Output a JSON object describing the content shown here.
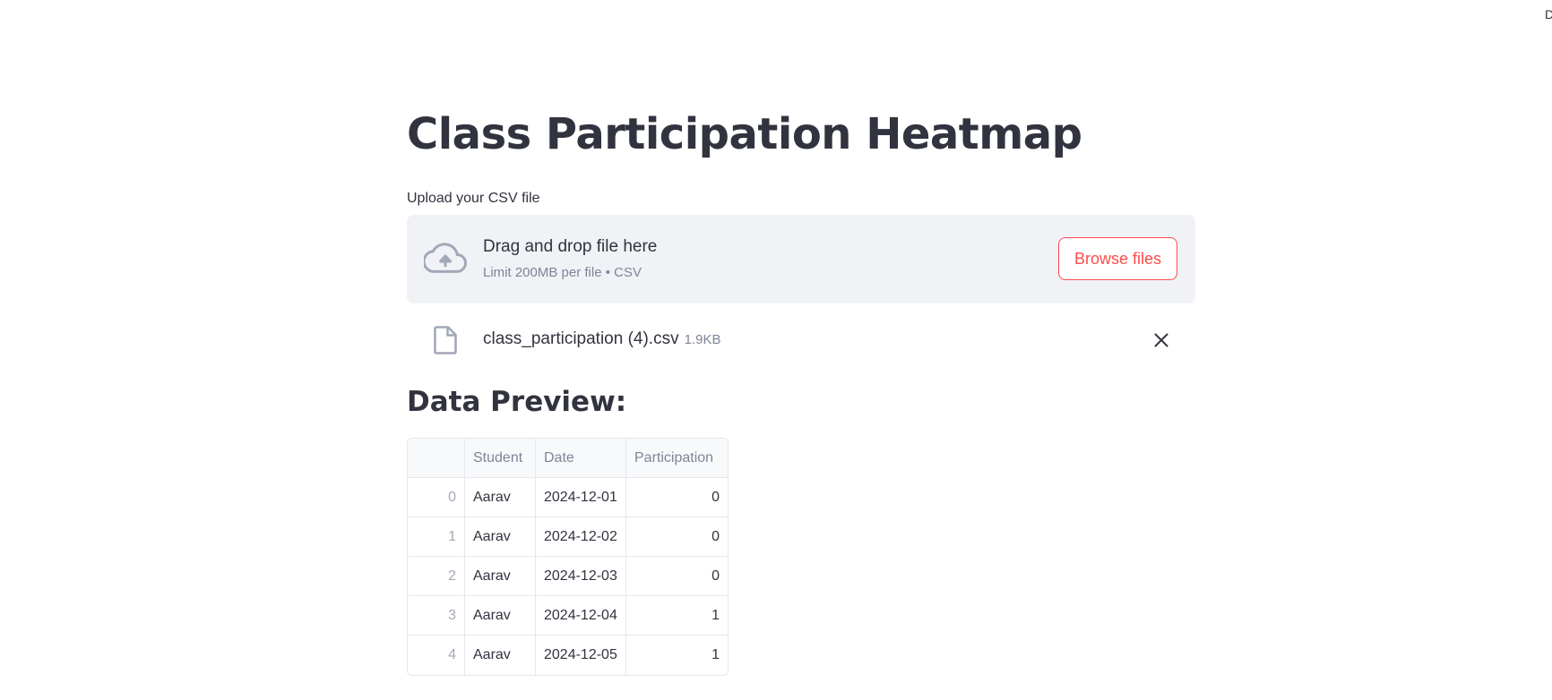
{
  "header": {
    "deploy_fragment": "D"
  },
  "page": {
    "title": "Class Participation Heatmap"
  },
  "uploader": {
    "label": "Upload your CSV file",
    "drop_title": "Drag and drop file here",
    "drop_subtitle": "Limit 200MB per file • CSV",
    "browse_label": "Browse files",
    "file": {
      "name": "class_participation (4).csv",
      "size": "1.9KB"
    }
  },
  "preview": {
    "heading": "Data Preview:",
    "columns": [
      "",
      "Student",
      "Date",
      "Participation"
    ],
    "rows": [
      {
        "index": "0",
        "student": "Aarav",
        "date": "2024-12-01",
        "participation": "0"
      },
      {
        "index": "1",
        "student": "Aarav",
        "date": "2024-12-02",
        "participation": "0"
      },
      {
        "index": "2",
        "student": "Aarav",
        "date": "2024-12-03",
        "participation": "0"
      },
      {
        "index": "3",
        "student": "Aarav",
        "date": "2024-12-04",
        "participation": "1"
      },
      {
        "index": "4",
        "student": "Aarav",
        "date": "2024-12-05",
        "participation": "1"
      }
    ]
  },
  "colors": {
    "accent": "#ff4b4b",
    "text": "#31333f",
    "muted": "#808495",
    "dropzone_bg": "#f0f2f6"
  }
}
